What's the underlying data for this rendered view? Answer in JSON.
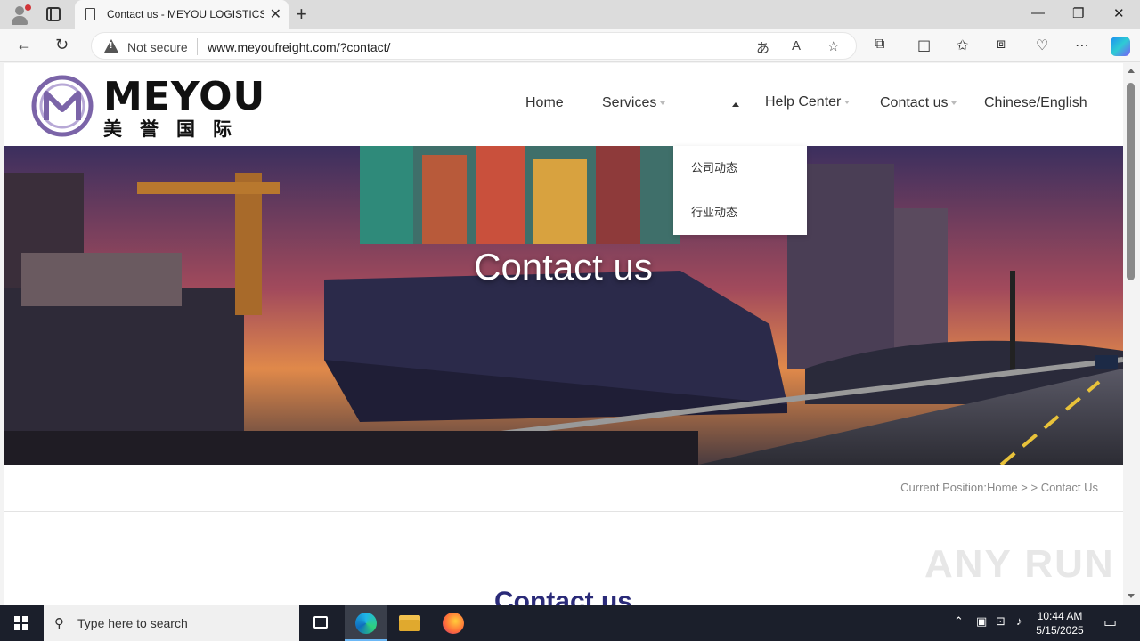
{
  "browser": {
    "tab_title": "Contact us - MEYOU LOGISTICS LT",
    "new_tab": "+",
    "tab_close": "✕",
    "security_label": "Not secure",
    "url": "www.meyoufreight.com/?contact/",
    "minimize": "—",
    "restore": "❐",
    "close": "✕"
  },
  "site": {
    "logo_text": "MEYOU",
    "logo_cn": "美誉国际",
    "nav": {
      "home": "Home",
      "services": "Services",
      "help_center": "Help Center",
      "contact_us": "Contact us",
      "language": "Chinese/English"
    },
    "dropdown": [
      "公司动态",
      "行业动态"
    ],
    "banner_title": "Contact us",
    "breadcrumb": {
      "prefix": "Current Position:",
      "home": "Home",
      "separator": " > > ",
      "current": "Contact Us"
    },
    "section_title": "Contact us",
    "watermark": "ANY RUN"
  },
  "taskbar": {
    "search_placeholder": "Type here to search",
    "time": "10:44 AM",
    "date": "5/15/2025"
  },
  "colors": {
    "section_title": "#2a2a78",
    "logo_purple": "#7b64a8"
  }
}
